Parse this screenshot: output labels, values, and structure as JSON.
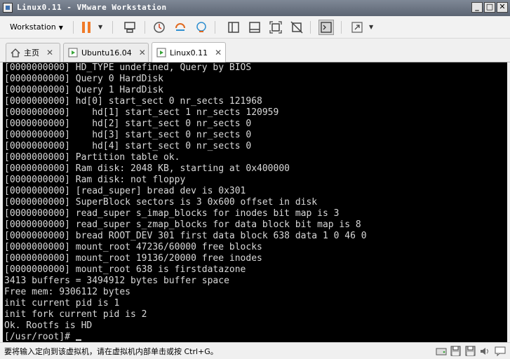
{
  "window": {
    "title": "Linux0.11 - VMware Workstation",
    "minimize": "_",
    "maximize": "□",
    "close": "✕"
  },
  "toolbar": {
    "menu_label": "Workstation",
    "icons": [
      "pause-icon",
      "send-keys-icon",
      "snapshot-icon",
      "revert-snapshot-icon",
      "snapshot-manager-icon",
      "sidebar-icon",
      "thumbnail-icon",
      "fullscreen-icon",
      "unity-icon",
      "console-view-icon",
      "stretch-icon"
    ]
  },
  "tabs": [
    {
      "label": "主页",
      "icon": "home-icon",
      "active": false
    },
    {
      "label": "Ubuntu16.04",
      "icon": "vm-icon",
      "active": false
    },
    {
      "label": "Linux0.11",
      "icon": "vm-icon",
      "active": true
    }
  ],
  "console": {
    "lines": [
      "[0000000000] HD_TYPE undefined, Query by BIOS",
      "[0000000000] Query 0 HardDisk",
      "[0000000000] Query 1 HardDisk",
      "[0000000000] hd[0] start_sect 0 nr_sects 121968",
      "[0000000000]    hd[1] start_sect 1 nr_sects 120959",
      "[0000000000]    hd[2] start_sect 0 nr_sects 0",
      "[0000000000]    hd[3] start_sect 0 nr_sects 0",
      "[0000000000]    hd[4] start_sect 0 nr_sects 0",
      "[0000000000] Partition table ok.",
      "[0000000000] Ram disk: 2048 KB, starting at 0x400000",
      "[0000000000] Ram disk: not floppy",
      "[0000000000] [read_super] bread dev is 0x301",
      "[0000000000] SuperBlock sectors is 3 0x600 offset in disk",
      "[0000000000] read_super s_imap_blocks for inodes bit map is 3",
      "[0000000000] read_super s_zmap_blocks for data block bit map is 8",
      "[0000000000] bread ROOT_DEV 301 first data block 638 data 1 0 46 0",
      "[0000000000] mount_root 47236/60000 free blocks",
      "[0000000000] mount_root 19136/20000 free inodes",
      "[0000000000] mount_root 638 is firstdatazone",
      "3413 buffers = 3494912 bytes buffer space",
      "Free mem: 9306112 bytes",
      "init current pid is 1",
      "init fork current pid is 2",
      "Ok. Rootfs is HD",
      "[/usr/root]# "
    ]
  },
  "statusbar": {
    "message": "要将输入定向到该虚拟机，请在虚拟机内部单击或按 Ctrl+G。",
    "icons": [
      "hard-disk-icon",
      "floppy-icon",
      "floppy-icon",
      "sound-icon",
      "message-log-icon"
    ]
  },
  "colors": {
    "titlebar": "#5c6573",
    "pause_accent": "#f07a28",
    "console_bg": "#000000",
    "console_text": "#d9d9d9"
  }
}
